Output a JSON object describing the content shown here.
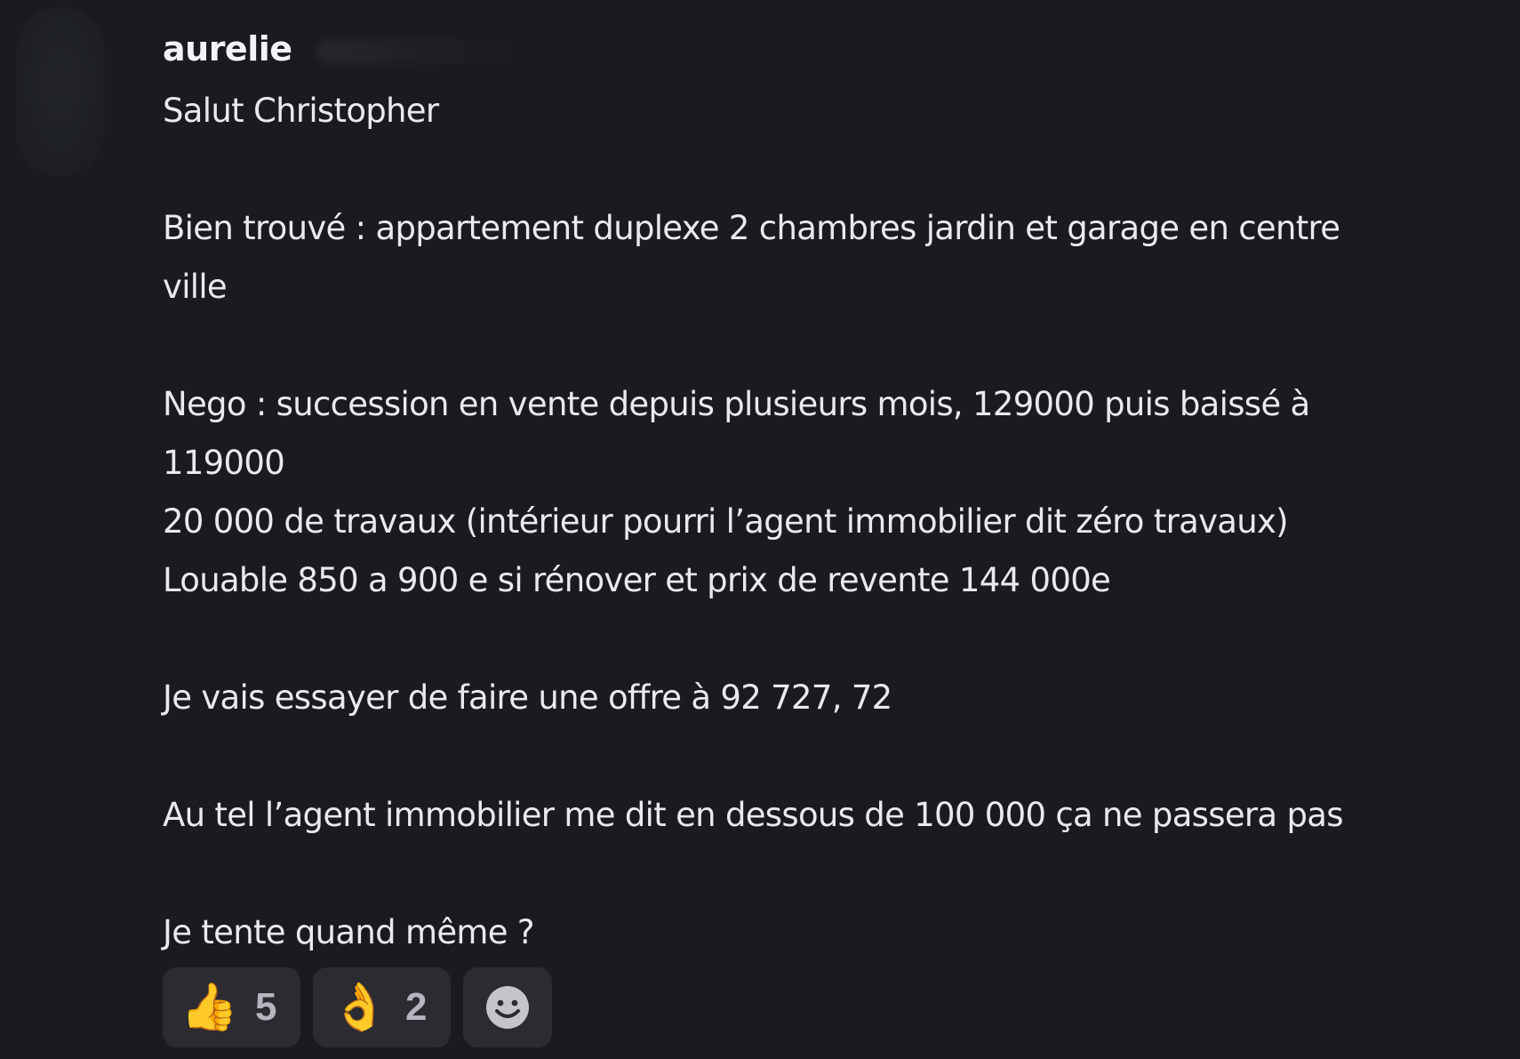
{
  "message": {
    "author": "aurelie",
    "lines": [
      "Salut Christopher",
      "",
      "Bien trouvé : appartement duplexe 2 chambres jardin et garage en centre",
      "ville",
      "",
      "Nego : succession en vente depuis plusieurs mois, 129000 puis baissé à",
      "119000",
      "20 000 de travaux (intérieur pourri l’agent immobilier dit zéro travaux)",
      "Louable 850 a 900 e si rénover et prix de revente 144 000e",
      "",
      "Je vais essayer de faire une offre à 92 727, 72",
      "",
      "Au tel l’agent immobilier me dit en dessous de 100 000 ça ne passera pas",
      "",
      "Je tente quand même ?"
    ]
  },
  "reactions": [
    {
      "emoji": "👍",
      "icon": "thumbs-up-icon",
      "count": "5"
    },
    {
      "emoji": "👌",
      "icon": "ok-hand-icon",
      "count": "2"
    }
  ],
  "add_reaction": {
    "icon": "smiley-add-reaction-icon"
  },
  "colors": {
    "background": "#1b1b1f",
    "text": "#e9e9ee",
    "reaction_bg": "#2b2b31",
    "count_text": "#b5b6bd"
  }
}
